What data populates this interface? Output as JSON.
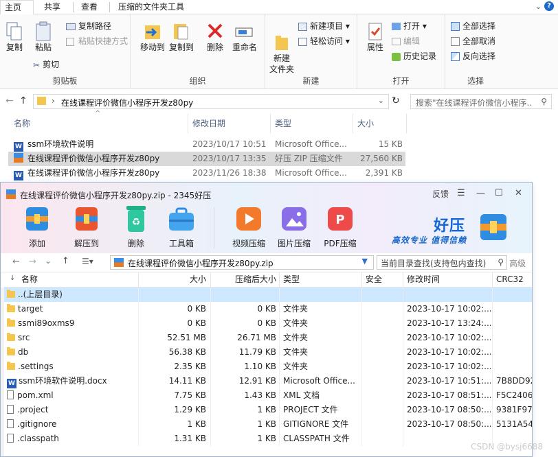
{
  "explorer": {
    "tabs": [
      "主页",
      "共享",
      "查看",
      "压缩的文件夹工具"
    ],
    "ribbon": {
      "clipboard": {
        "label": "剪贴板",
        "copy": "复制",
        "paste": "粘贴",
        "copy_path": "复制路径",
        "paste_shortcut": "粘贴快捷方式",
        "cut": "剪切"
      },
      "organize": {
        "label": "组织",
        "move_to": "移动到",
        "copy_to": "复制到",
        "delete": "删除",
        "rename": "重命名"
      },
      "new": {
        "label": "新建",
        "new_folder": "新建\n文件夹",
        "new_item": "新建项目",
        "easy_access": "轻松访问"
      },
      "open": {
        "label": "打开",
        "properties": "属性",
        "open": "打开",
        "edit": "编辑",
        "history": "历史记录"
      },
      "select": {
        "label": "选择",
        "select_all": "全部选择",
        "select_none": "全部取消",
        "invert": "反向选择"
      }
    },
    "address": "在线课程评价微信小程序开发z80py",
    "search_placeholder": "搜索\"在线课程评价微信小程序...",
    "columns": {
      "name": "名称",
      "date": "修改日期",
      "type": "类型",
      "size": "大小"
    },
    "files": [
      {
        "name": "ssm环境软件说明",
        "date": "2023/10/17 10:51",
        "type": "Microsoft Office...",
        "size": "15 KB",
        "icon": "word-doc-icon"
      },
      {
        "name": "在线课程评价微信小程序开发z80py",
        "date": "2023/10/17 13:35",
        "type": "好压 ZIP 压缩文件",
        "size": "27,560 KB",
        "icon": "zip-archive-icon"
      },
      {
        "name": "在线课程评价微信小程序开发z80py",
        "date": "2023/11/26 18:38",
        "type": "Microsoft Office...",
        "size": "2,391 KB",
        "icon": "word-doc-icon"
      }
    ]
  },
  "haozip": {
    "title": "在线课程评价微信小程序开发z80py.zip - 2345好压",
    "feedback": "反馈",
    "toolbar": [
      "添加",
      "解压到",
      "删除",
      "工具箱",
      "视频压缩",
      "图片压缩",
      "PDF压缩"
    ],
    "brand": "好压",
    "slogan": "高效专业  值得信赖",
    "path": "在线课程评价微信小程序开发z80py.zip",
    "search_placeholder": "当前目录查找(支持包内查找)",
    "advanced": "高级",
    "columns": {
      "name": "名称",
      "size": "大小",
      "packed": "压缩后大小",
      "type": "类型",
      "security": "安全",
      "modified": "修改时间",
      "crc": "CRC32"
    },
    "rows": [
      {
        "name": "..(上层目录)",
        "size": "",
        "packed": "",
        "type": "",
        "modified": "",
        "crc": "",
        "icon": "folder-icon"
      },
      {
        "name": "target",
        "size": "0 KB",
        "packed": "0 KB",
        "type": "文件夹",
        "modified": "2023-10-17 10:02:...",
        "crc": "",
        "icon": "folder-icon"
      },
      {
        "name": "ssmi89oxms9",
        "size": "0 KB",
        "packed": "0 KB",
        "type": "文件夹",
        "modified": "2023-10-17 13:24:...",
        "crc": "",
        "icon": "folder-icon"
      },
      {
        "name": "src",
        "size": "52.51 MB",
        "packed": "26.71 MB",
        "type": "文件夹",
        "modified": "2023-10-17 10:02:...",
        "crc": "",
        "icon": "folder-icon"
      },
      {
        "name": "db",
        "size": "56.38 KB",
        "packed": "11.79 KB",
        "type": "文件夹",
        "modified": "2023-10-17 10:02:...",
        "crc": "",
        "icon": "folder-icon"
      },
      {
        "name": ".settings",
        "size": "2.35 KB",
        "packed": "1.10 KB",
        "type": "文件夹",
        "modified": "2023-10-17 10:02:...",
        "crc": "",
        "icon": "folder-icon"
      },
      {
        "name": "ssm环境软件说明.docx",
        "size": "14.11 KB",
        "packed": "12.91 KB",
        "type": "Microsoft Office...",
        "modified": "2023-10-17 10:51:...",
        "crc": "7B8DD92",
        "icon": "word-doc-icon"
      },
      {
        "name": "pom.xml",
        "size": "7.75 KB",
        "packed": "1.43 KB",
        "type": "XML 文档",
        "modified": "2023-10-17 08:51:...",
        "crc": "F5C2406",
        "icon": "file-icon"
      },
      {
        "name": ".project",
        "size": "1.29 KB",
        "packed": "1 KB",
        "type": "PROJECT 文件",
        "modified": "2023-10-17 08:50:...",
        "crc": "9381F97",
        "icon": "file-icon"
      },
      {
        "name": ".gitignore",
        "size": "1 KB",
        "packed": "1 KB",
        "type": "GITIGNORE 文件",
        "modified": "2023-10-17 08:50:...",
        "crc": "5131A54",
        "icon": "file-icon"
      },
      {
        "name": ".classpath",
        "size": "1.31 KB",
        "packed": "1 KB",
        "type": "CLASSPATH 文件",
        "modified": "",
        "crc": "",
        "icon": "file-icon"
      }
    ]
  },
  "watermark": "CSDN @bysj6688"
}
